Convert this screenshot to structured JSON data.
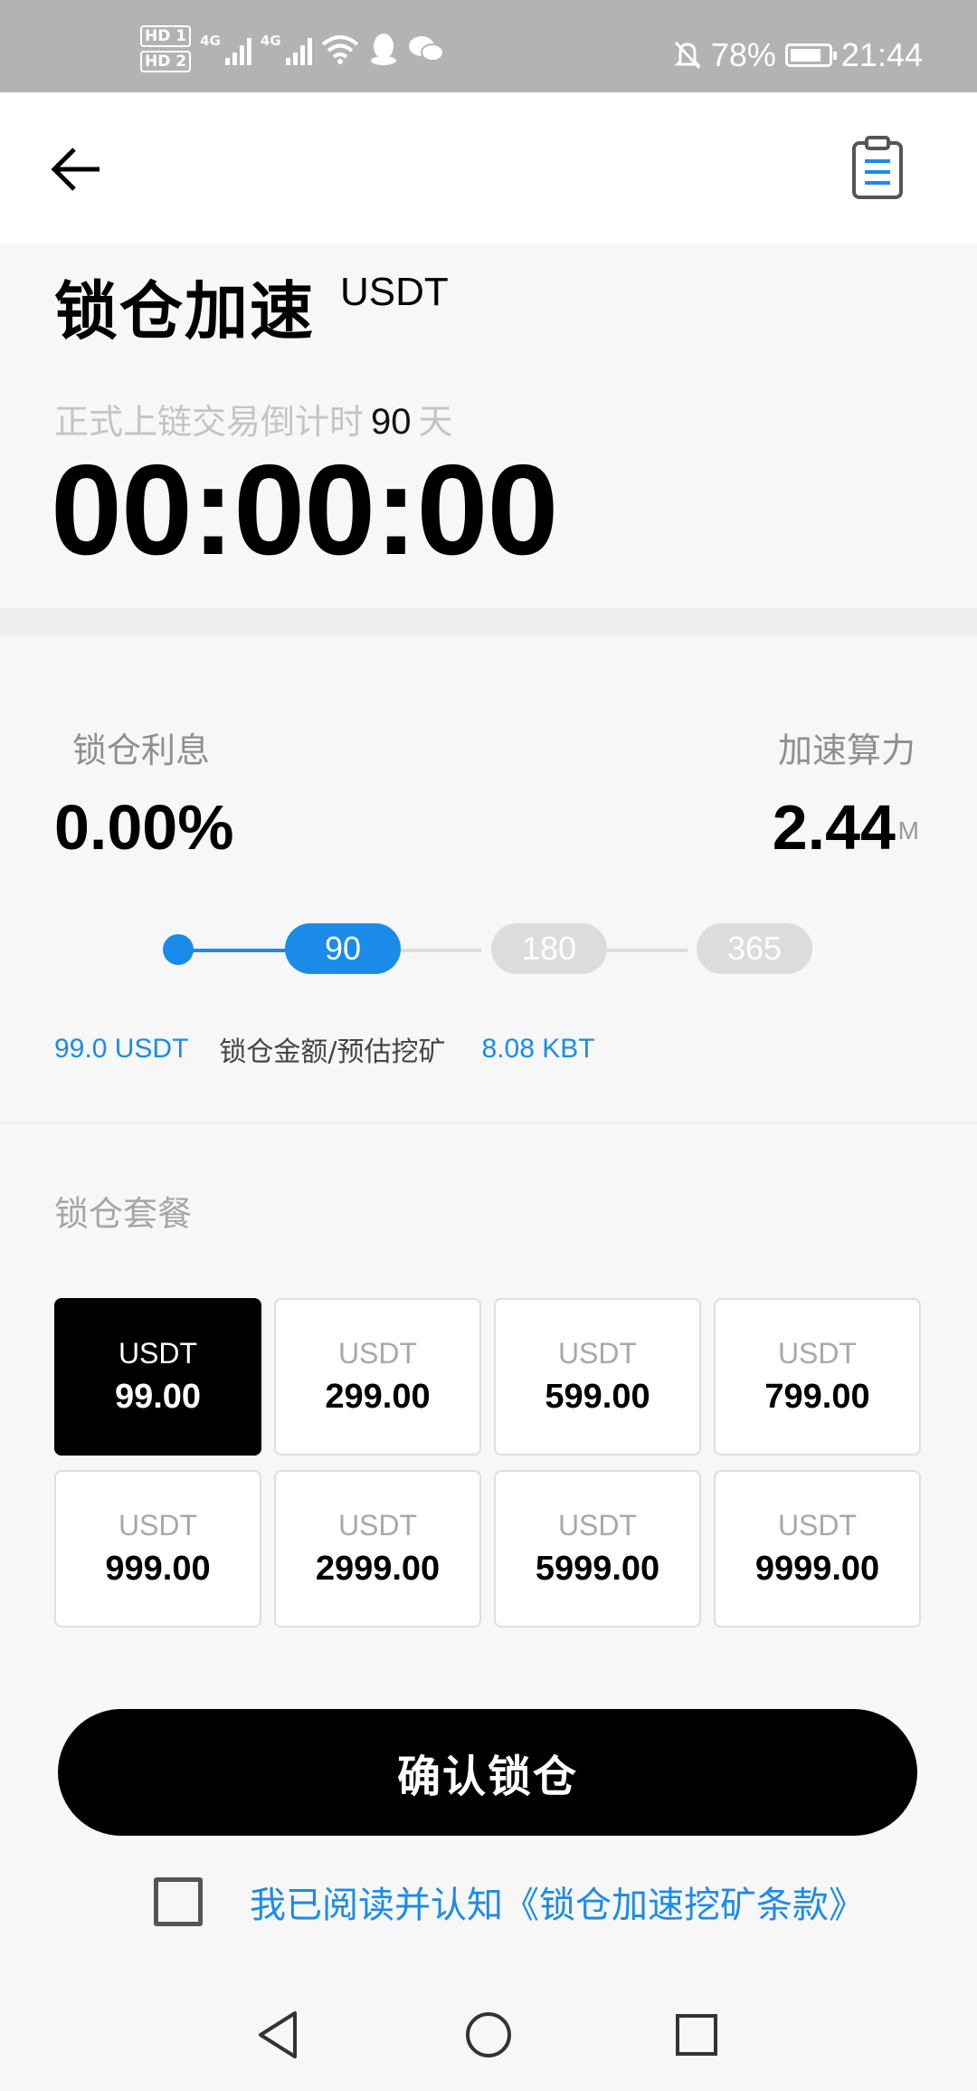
{
  "status_bar": {
    "hd1": "HD 1",
    "hd2": "HD 2",
    "signal_label": "4G",
    "battery_text": "78%",
    "time": "21:44"
  },
  "header": {
    "back_icon": "arrow-left-icon",
    "clipboard_icon": "clipboard-icon"
  },
  "page": {
    "title": "锁仓加速",
    "currency": "USDT",
    "countdown_prefix": "正式上链交易倒计时",
    "countdown_days": "90",
    "countdown_suffix": "天",
    "timer": "00:00:00"
  },
  "stats": {
    "interest_label": "锁仓利息",
    "interest_value": "0.00%",
    "hashrate_label": "加速算力",
    "hashrate_value": "2.44",
    "hashrate_unit": "M"
  },
  "periods": [
    "90",
    "180",
    "365"
  ],
  "selected_period": "90",
  "summary": {
    "lock_amount": "99.0 USDT",
    "label": "锁仓金额/预估挖矿",
    "estimated_mining": "8.08 KBT"
  },
  "packages": {
    "title": "锁仓套餐",
    "items": [
      {
        "currency": "USDT",
        "amount": "99.00"
      },
      {
        "currency": "USDT",
        "amount": "299.00"
      },
      {
        "currency": "USDT",
        "amount": "599.00"
      },
      {
        "currency": "USDT",
        "amount": "799.00"
      },
      {
        "currency": "USDT",
        "amount": "999.00"
      },
      {
        "currency": "USDT",
        "amount": "2999.00"
      },
      {
        "currency": "USDT",
        "amount": "5999.00"
      },
      {
        "currency": "USDT",
        "amount": "9999.00"
      }
    ],
    "selected_index": 0
  },
  "confirm_label": "确认锁仓",
  "agreement": {
    "text": "我已阅读并认知《锁仓加速挖矿条款》",
    "checked": false
  },
  "colors": {
    "accent": "#1b8bea",
    "primary": "#000000",
    "status_bar": "#b3b3b3"
  }
}
